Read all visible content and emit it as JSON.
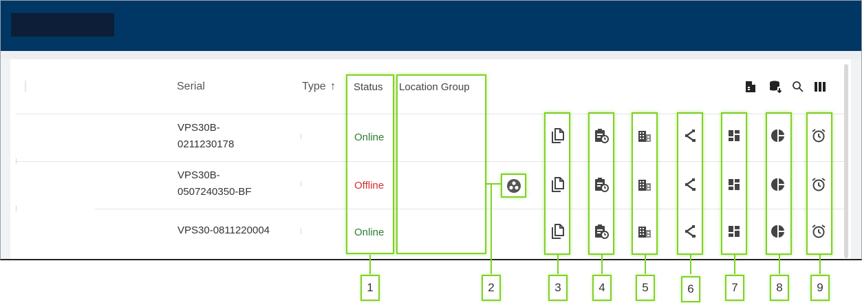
{
  "table": {
    "headers": {
      "serial": "Serial",
      "type": "Type",
      "status": "Status",
      "location_group": "Location Group"
    },
    "sort_icon": "arrow-up-icon",
    "toolbar_icons": [
      "export-file-icon",
      "database-export-icon",
      "search-icon",
      "view-columns-icon"
    ],
    "rows": [
      {
        "serial_line1": "VPS30B-",
        "serial_line2": "0211230178",
        "status": "Online"
      },
      {
        "serial_line1": "VPS30B-",
        "serial_line2": "0507240350-BF",
        "status": "Offline"
      },
      {
        "serial_line1": "VPS30-0811220004",
        "serial_line2": "",
        "status": "Online"
      }
    ],
    "row_action_icons": [
      "copy-icon",
      "schedule-clipboard-icon",
      "building-icon",
      "share-icon",
      "dashboard-icon",
      "pie-chart-icon",
      "alarm-clock-icon"
    ]
  },
  "group_button_icon": "group-icon",
  "callouts": [
    "1",
    "2",
    "3",
    "4",
    "5",
    "6",
    "7",
    "8",
    "9"
  ],
  "colors": {
    "header_bar": "#003764",
    "logo_block": "#0d1e38",
    "highlight": "#7ed321",
    "online": "#2e7d32",
    "offline": "#d32f2f"
  }
}
